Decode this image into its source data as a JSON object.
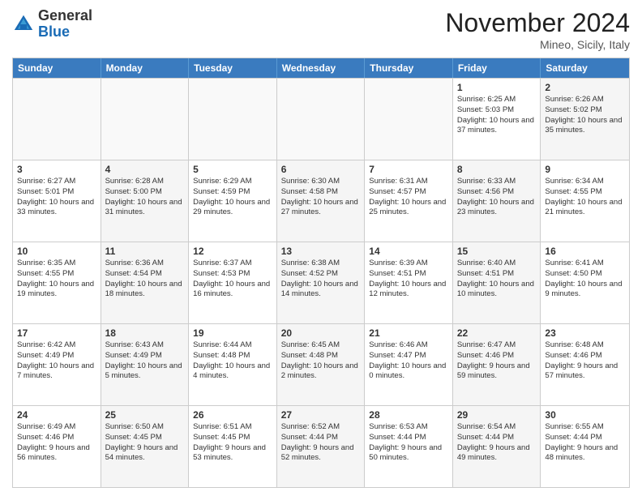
{
  "header": {
    "logo_general": "General",
    "logo_blue": "Blue",
    "month_title": "November 2024",
    "location": "Mineo, Sicily, Italy"
  },
  "calendar": {
    "days_of_week": [
      "Sunday",
      "Monday",
      "Tuesday",
      "Wednesday",
      "Thursday",
      "Friday",
      "Saturday"
    ],
    "rows": [
      [
        {
          "day": "",
          "empty": true
        },
        {
          "day": "",
          "empty": true
        },
        {
          "day": "",
          "empty": true
        },
        {
          "day": "",
          "empty": true
        },
        {
          "day": "",
          "empty": true
        },
        {
          "day": "1",
          "empty": false,
          "shaded": false,
          "text": "Sunrise: 6:25 AM\nSunset: 5:03 PM\nDaylight: 10 hours and 37 minutes."
        },
        {
          "day": "2",
          "empty": false,
          "shaded": true,
          "text": "Sunrise: 6:26 AM\nSunset: 5:02 PM\nDaylight: 10 hours and 35 minutes."
        }
      ],
      [
        {
          "day": "3",
          "empty": false,
          "shaded": false,
          "text": "Sunrise: 6:27 AM\nSunset: 5:01 PM\nDaylight: 10 hours and 33 minutes."
        },
        {
          "day": "4",
          "empty": false,
          "shaded": true,
          "text": "Sunrise: 6:28 AM\nSunset: 5:00 PM\nDaylight: 10 hours and 31 minutes."
        },
        {
          "day": "5",
          "empty": false,
          "shaded": false,
          "text": "Sunrise: 6:29 AM\nSunset: 4:59 PM\nDaylight: 10 hours and 29 minutes."
        },
        {
          "day": "6",
          "empty": false,
          "shaded": true,
          "text": "Sunrise: 6:30 AM\nSunset: 4:58 PM\nDaylight: 10 hours and 27 minutes."
        },
        {
          "day": "7",
          "empty": false,
          "shaded": false,
          "text": "Sunrise: 6:31 AM\nSunset: 4:57 PM\nDaylight: 10 hours and 25 minutes."
        },
        {
          "day": "8",
          "empty": false,
          "shaded": true,
          "text": "Sunrise: 6:33 AM\nSunset: 4:56 PM\nDaylight: 10 hours and 23 minutes."
        },
        {
          "day": "9",
          "empty": false,
          "shaded": false,
          "text": "Sunrise: 6:34 AM\nSunset: 4:55 PM\nDaylight: 10 hours and 21 minutes."
        }
      ],
      [
        {
          "day": "10",
          "empty": false,
          "shaded": false,
          "text": "Sunrise: 6:35 AM\nSunset: 4:55 PM\nDaylight: 10 hours and 19 minutes."
        },
        {
          "day": "11",
          "empty": false,
          "shaded": true,
          "text": "Sunrise: 6:36 AM\nSunset: 4:54 PM\nDaylight: 10 hours and 18 minutes."
        },
        {
          "day": "12",
          "empty": false,
          "shaded": false,
          "text": "Sunrise: 6:37 AM\nSunset: 4:53 PM\nDaylight: 10 hours and 16 minutes."
        },
        {
          "day": "13",
          "empty": false,
          "shaded": true,
          "text": "Sunrise: 6:38 AM\nSunset: 4:52 PM\nDaylight: 10 hours and 14 minutes."
        },
        {
          "day": "14",
          "empty": false,
          "shaded": false,
          "text": "Sunrise: 6:39 AM\nSunset: 4:51 PM\nDaylight: 10 hours and 12 minutes."
        },
        {
          "day": "15",
          "empty": false,
          "shaded": true,
          "text": "Sunrise: 6:40 AM\nSunset: 4:51 PM\nDaylight: 10 hours and 10 minutes."
        },
        {
          "day": "16",
          "empty": false,
          "shaded": false,
          "text": "Sunrise: 6:41 AM\nSunset: 4:50 PM\nDaylight: 10 hours and 9 minutes."
        }
      ],
      [
        {
          "day": "17",
          "empty": false,
          "shaded": false,
          "text": "Sunrise: 6:42 AM\nSunset: 4:49 PM\nDaylight: 10 hours and 7 minutes."
        },
        {
          "day": "18",
          "empty": false,
          "shaded": true,
          "text": "Sunrise: 6:43 AM\nSunset: 4:49 PM\nDaylight: 10 hours and 5 minutes."
        },
        {
          "day": "19",
          "empty": false,
          "shaded": false,
          "text": "Sunrise: 6:44 AM\nSunset: 4:48 PM\nDaylight: 10 hours and 4 minutes."
        },
        {
          "day": "20",
          "empty": false,
          "shaded": true,
          "text": "Sunrise: 6:45 AM\nSunset: 4:48 PM\nDaylight: 10 hours and 2 minutes."
        },
        {
          "day": "21",
          "empty": false,
          "shaded": false,
          "text": "Sunrise: 6:46 AM\nSunset: 4:47 PM\nDaylight: 10 hours and 0 minutes."
        },
        {
          "day": "22",
          "empty": false,
          "shaded": true,
          "text": "Sunrise: 6:47 AM\nSunset: 4:46 PM\nDaylight: 9 hours and 59 minutes."
        },
        {
          "day": "23",
          "empty": false,
          "shaded": false,
          "text": "Sunrise: 6:48 AM\nSunset: 4:46 PM\nDaylight: 9 hours and 57 minutes."
        }
      ],
      [
        {
          "day": "24",
          "empty": false,
          "shaded": false,
          "text": "Sunrise: 6:49 AM\nSunset: 4:46 PM\nDaylight: 9 hours and 56 minutes."
        },
        {
          "day": "25",
          "empty": false,
          "shaded": true,
          "text": "Sunrise: 6:50 AM\nSunset: 4:45 PM\nDaylight: 9 hours and 54 minutes."
        },
        {
          "day": "26",
          "empty": false,
          "shaded": false,
          "text": "Sunrise: 6:51 AM\nSunset: 4:45 PM\nDaylight: 9 hours and 53 minutes."
        },
        {
          "day": "27",
          "empty": false,
          "shaded": true,
          "text": "Sunrise: 6:52 AM\nSunset: 4:44 PM\nDaylight: 9 hours and 52 minutes."
        },
        {
          "day": "28",
          "empty": false,
          "shaded": false,
          "text": "Sunrise: 6:53 AM\nSunset: 4:44 PM\nDaylight: 9 hours and 50 minutes."
        },
        {
          "day": "29",
          "empty": false,
          "shaded": true,
          "text": "Sunrise: 6:54 AM\nSunset: 4:44 PM\nDaylight: 9 hours and 49 minutes."
        },
        {
          "day": "30",
          "empty": false,
          "shaded": false,
          "text": "Sunrise: 6:55 AM\nSunset: 4:44 PM\nDaylight: 9 hours and 48 minutes."
        }
      ]
    ]
  }
}
